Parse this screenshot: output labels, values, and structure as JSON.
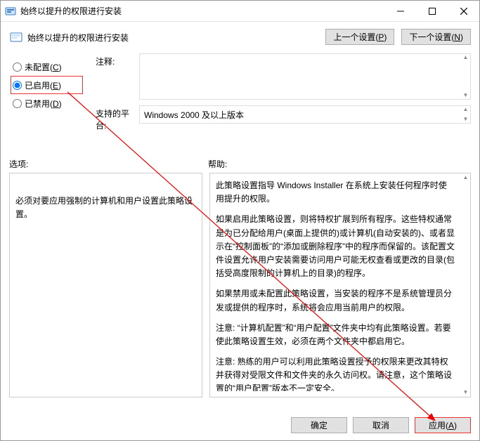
{
  "title": "始终以提升的权限进行安装",
  "header_title": "始终以提升的权限进行安装",
  "nav": {
    "prev": "上一个设置(P)",
    "next": "下一个设置(N)"
  },
  "radios": {
    "not_configured": "未配置(C)",
    "enabled": "已启用(E)",
    "disabled": "已禁用(D)",
    "selected": "enabled"
  },
  "meta": {
    "comment_label": "注释:",
    "comment_value": "",
    "platform_label": "支持的平台:",
    "platform_value": "Windows 2000 及以上版本"
  },
  "options_label": "选项:",
  "help_label": "帮助:",
  "options_text": "必须对要应用强制的计算机和用户设置此策略设置。",
  "help_paragraphs": [
    "此策略设置指导 Windows Installer 在系统上安装任何程序时使用提升的权限。",
    "如果启用此策略设置，则将特权扩展到所有程序。这些特权通常是为已分配给用户(桌面上提供的)或计算机(自动安装的)、或者显示在“控制面板”的“添加或删除程序”中的程序而保留的。该配置文件设置允许用户安装需要访问用户可能无权查看或更改的目录(包括受高度限制的计算机上的目录)的程序。",
    "如果禁用或未配置此策略设置，当安装的程序不是系统管理员分发或提供的程序时，系统将会应用当前用户的权限。",
    "注意: “计算机配置”和“用户配置”文件夹中均有此策略设置。若要使此策略设置生效，必须在两个文件夹中都启用它。",
    "注意: 熟练的用户可以利用此策略设置授予的权限来更改其特权并获得对受限文件和文件夹的永久访问权。请注意，这个策略设置的“用户配置”版本不一定安全。"
  ],
  "footer": {
    "ok": "确定",
    "cancel": "取消",
    "apply": "应用(A)"
  }
}
